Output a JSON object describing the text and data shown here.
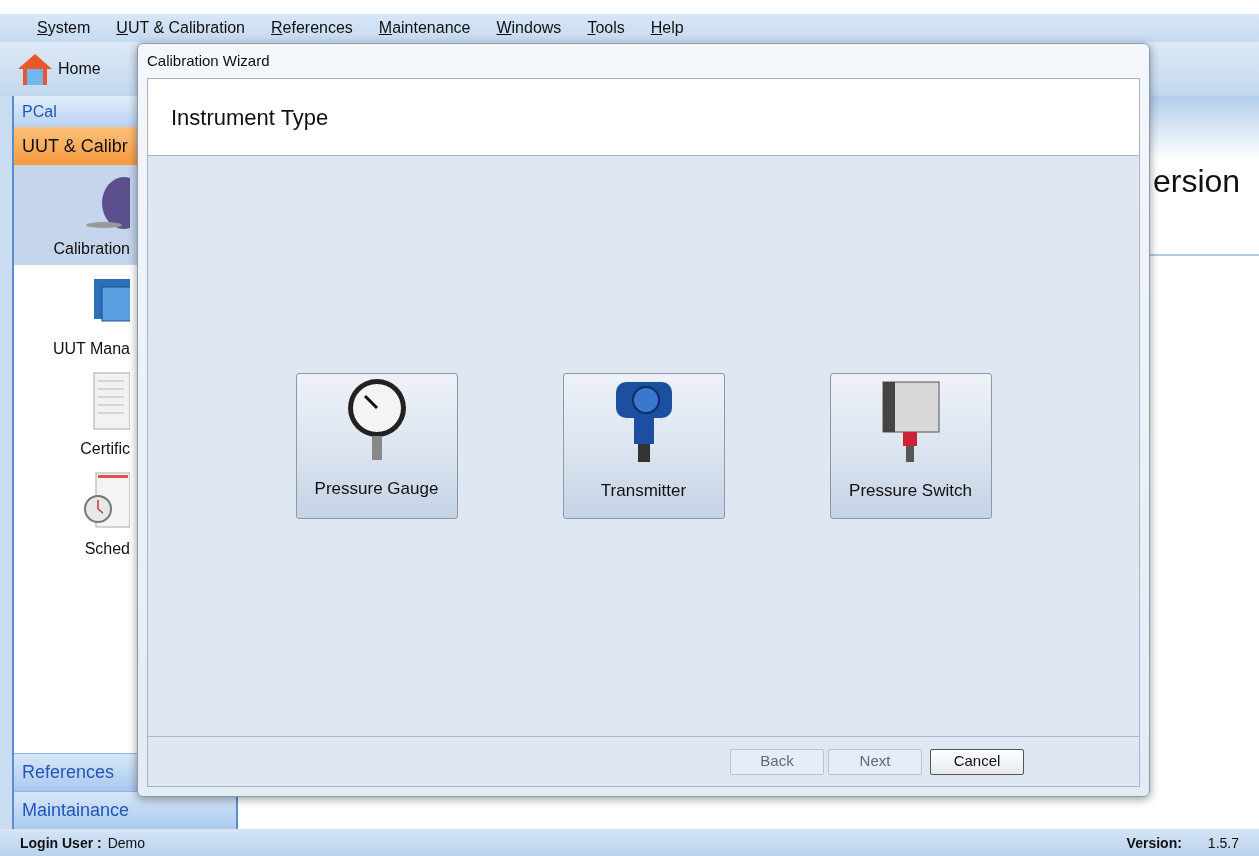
{
  "menu": [
    {
      "label": "System"
    },
    {
      "label": "UUT & Calibration"
    },
    {
      "label": "References"
    },
    {
      "label": "Maintenance"
    },
    {
      "label": "Windows"
    },
    {
      "label": "Tools"
    },
    {
      "label": "Help"
    }
  ],
  "toolbar": {
    "home": "Home"
  },
  "sidebar": {
    "app_title": "PCal",
    "group": "UUT & Calibr",
    "items": [
      {
        "kind": "calibration",
        "label": "Calibration",
        "selected": true
      },
      {
        "kind": "uut",
        "label": "UUT Mana",
        "selected": false
      },
      {
        "kind": "certificate",
        "label": "Certific",
        "selected": false
      },
      {
        "kind": "schedule",
        "label": "Sched",
        "selected": false
      }
    ],
    "bottom_groups": [
      "References",
      "Maintainance"
    ]
  },
  "content": {
    "heading": "ersion"
  },
  "dialog": {
    "title": "Calibration Wizard",
    "header": "Instrument Type",
    "options": [
      {
        "kind": "gauge",
        "label": "Pressure Gauge"
      },
      {
        "kind": "transmitter",
        "label": "Transmitter"
      },
      {
        "kind": "switch",
        "label": "Pressure Switch"
      }
    ],
    "buttons": [
      {
        "label": "Back",
        "disabled": true
      },
      {
        "label": "Next",
        "disabled": true
      },
      {
        "label": "Cancel",
        "disabled": false
      }
    ]
  },
  "status_bar": {
    "login_label": "Login User :",
    "login_value": "Demo",
    "version_label": "Version:",
    "version_value": "1.5.7"
  }
}
